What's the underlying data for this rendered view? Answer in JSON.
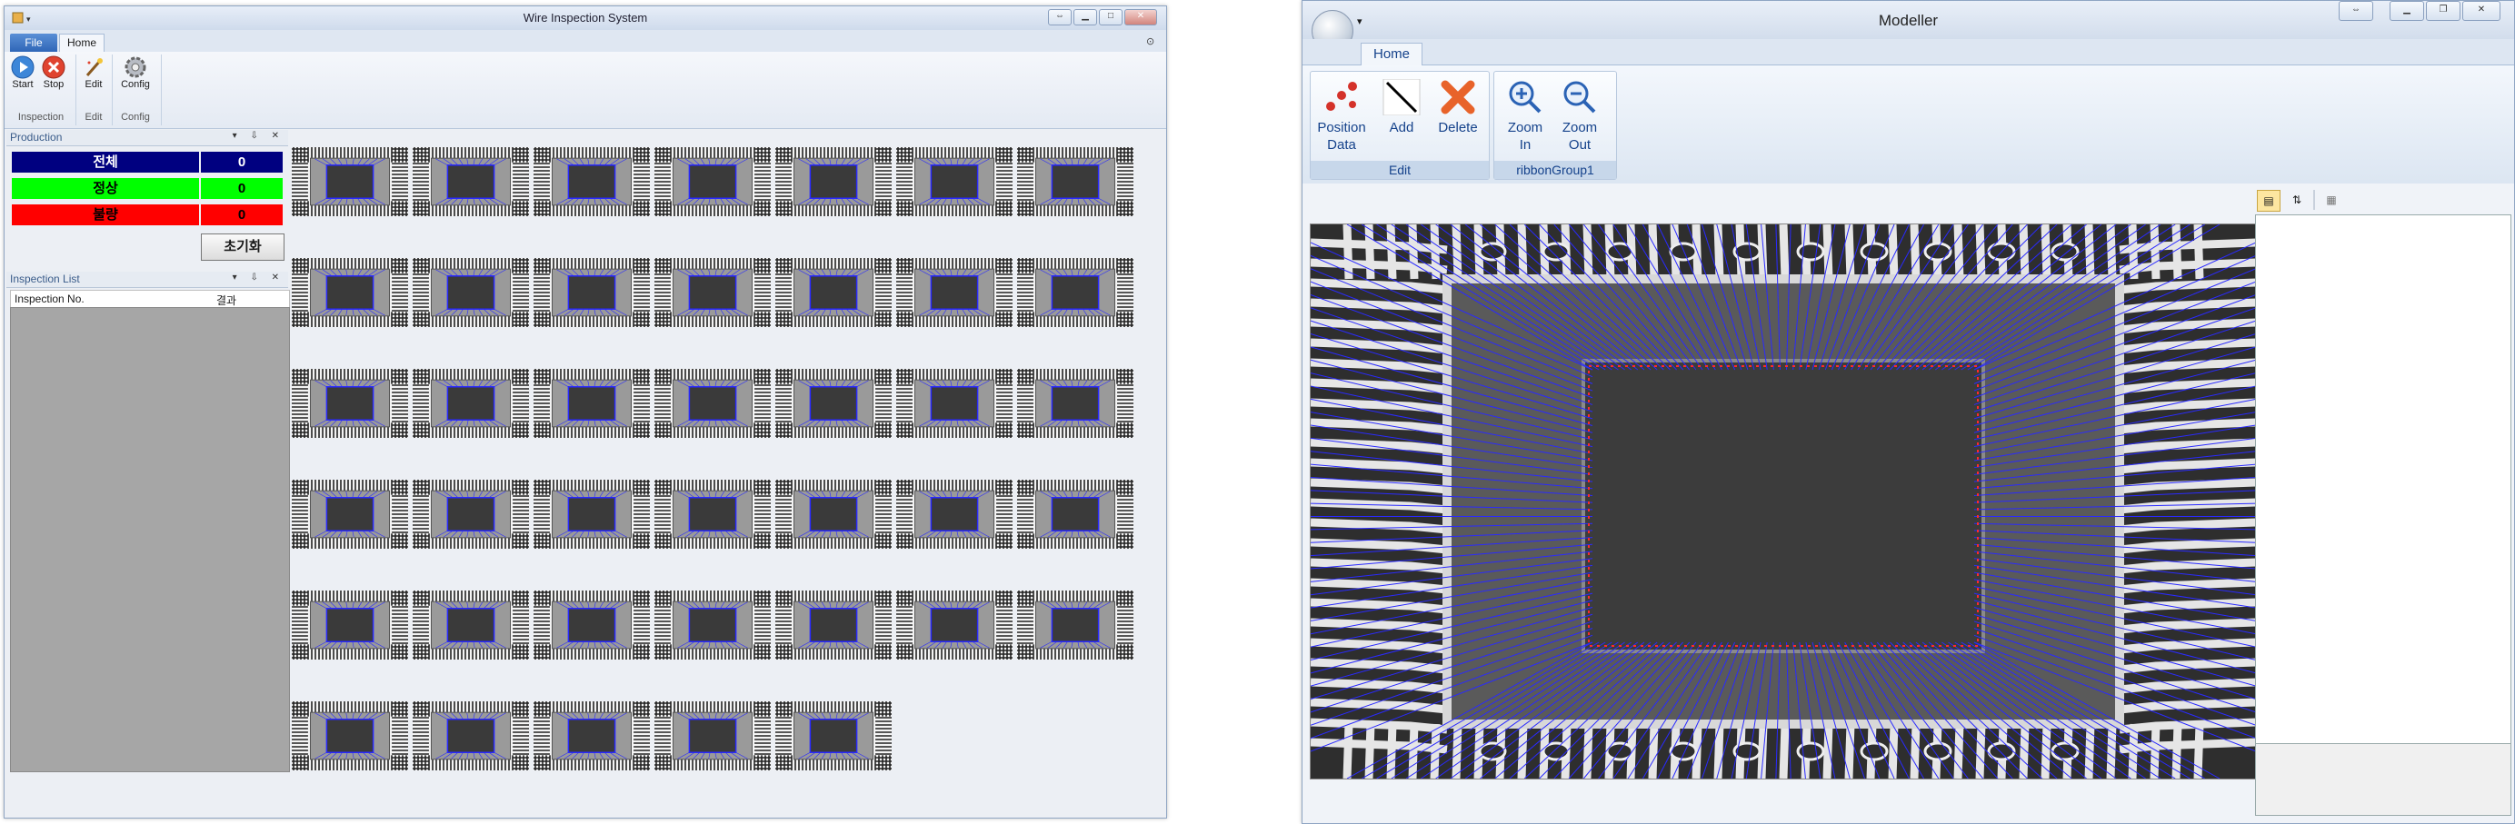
{
  "window1": {
    "title": "Wire Inspection System",
    "tabs": {
      "file": "File",
      "home": "Home"
    },
    "ribbon": {
      "start": "Start",
      "stop": "Stop",
      "edit": "Edit",
      "config": "Config",
      "group_inspection": "Inspection",
      "group_edit": "Edit",
      "group_config": "Config"
    },
    "production_panel": {
      "title": "Production",
      "rows": [
        {
          "label": "전체",
          "value": "0",
          "color": "#000080",
          "text_color": "#ffffff"
        },
        {
          "label": "정상",
          "value": "0",
          "color": "#00ff00",
          "text_color": "#000000"
        },
        {
          "label": "불량",
          "value": "0",
          "color": "#ff0000",
          "text_color": "#000000"
        }
      ],
      "reset_label": "초기화"
    },
    "inspection_list": {
      "title": "Inspection List",
      "columns": [
        "Inspection No.",
        "결과"
      ]
    },
    "thumbnail_count": 40
  },
  "window2": {
    "title": "Modeller",
    "tabs": {
      "home": "Home"
    },
    "ribbon": {
      "position_data": "Position\nData",
      "add": "Add",
      "delete": "Delete",
      "zoom_in": "Zoom\nIn",
      "zoom_out": "Zoom\nOut",
      "group_edit": "Edit",
      "group_ribbon1": "ribbonGroup1"
    }
  },
  "colors": {
    "ribbon_text": "#15428b",
    "wire": "#2a2aff",
    "bond": "#ff2a2a"
  }
}
